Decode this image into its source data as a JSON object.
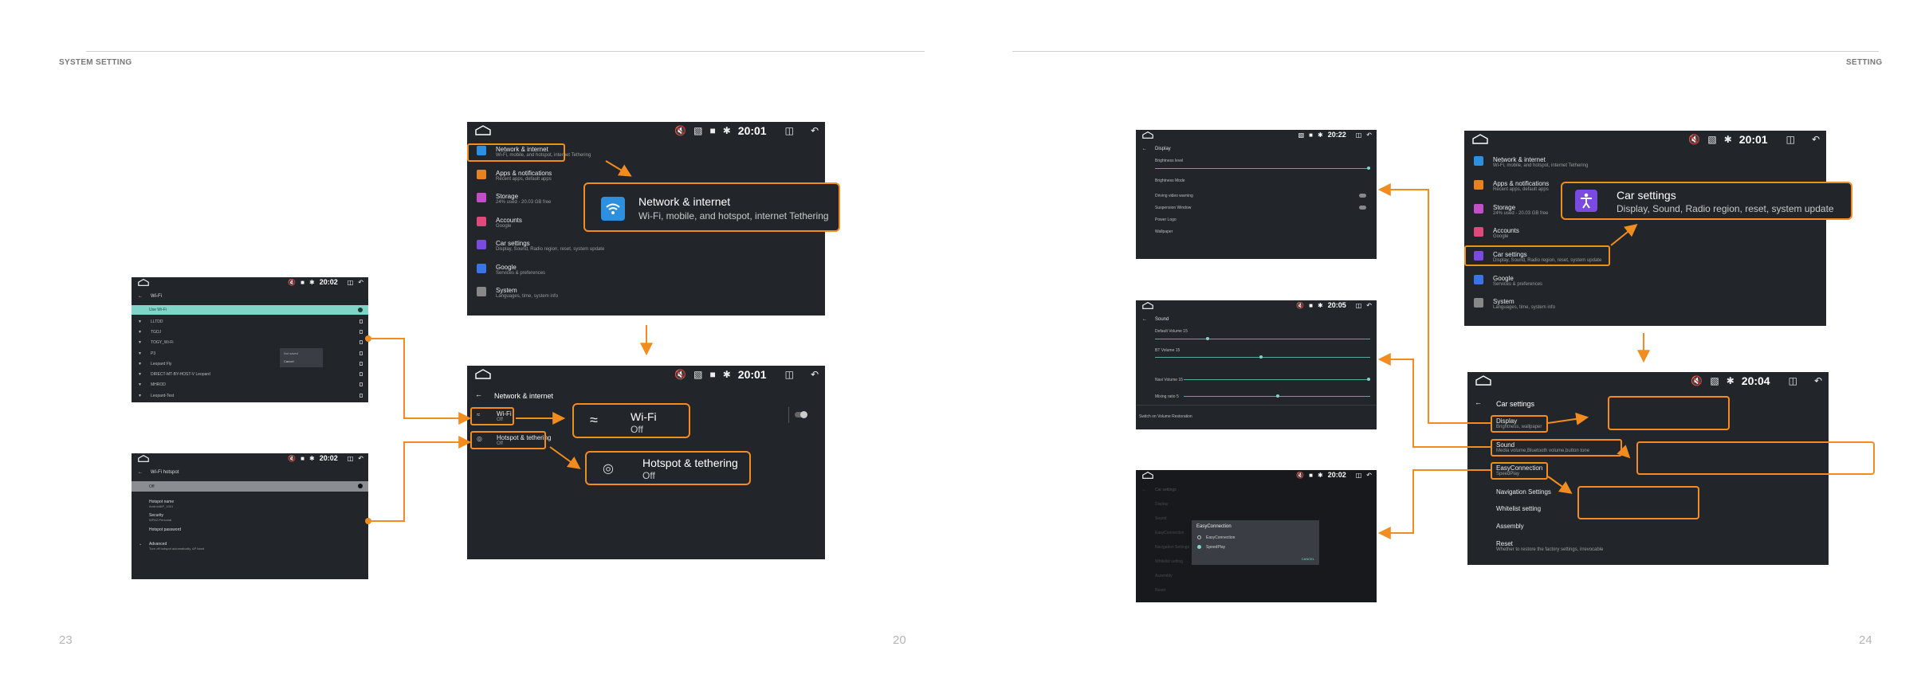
{
  "left_page": {
    "header": "SYSTEM SETTING",
    "page_number": "23",
    "page_number_right": "20"
  },
  "right_page": {
    "header": "SETTING",
    "page_number": "24"
  },
  "times": {
    "t2001": "20:01",
    "t2002": "20:02",
    "t2022": "20:22",
    "t2005": "20:05",
    "t2004": "20:04"
  },
  "settings_menu": {
    "items": [
      {
        "title": "Network & internet",
        "subtitle": "Wi-Fi, mobile, and hotspot, internet Tethering"
      },
      {
        "title": "Apps & notifications",
        "subtitle": "Recent apps, default apps"
      },
      {
        "title": "Storage",
        "subtitle": "24% used - 20.03 GB free"
      },
      {
        "title": "Accounts",
        "subtitle": "Google"
      },
      {
        "title": "Car settings",
        "subtitle": "Display, Sound, Radio region, reset, system update"
      },
      {
        "title": "Google",
        "subtitle": "Services & preferences"
      },
      {
        "title": "System",
        "subtitle": "Languages, time, system info"
      }
    ]
  },
  "network_callout": {
    "title": "Network & internet",
    "subtitle": "Wi-Fi, mobile, and hotspot, internet Tethering"
  },
  "network_screen": {
    "title": "Network & internet",
    "wifi": {
      "title": "Wi-Fi",
      "subtitle": "Off"
    },
    "hotspot": {
      "title": "Hotspot & tethering",
      "subtitle": "Off"
    }
  },
  "wifi_callout": {
    "title": "Wi-Fi",
    "subtitle": "Off"
  },
  "hotspot_callout": {
    "title": "Hotspot & tethering",
    "subtitle": "Off"
  },
  "wifi_screen": {
    "title": "Wi-Fi",
    "networks": [
      "Use Wi-Fi",
      "LLTDD",
      "TGDJ",
      "TOGY_Wi-Fi",
      "P3",
      "Leopard Fly",
      "DIRECT-MT-BY-HOST-V Leopard",
      "MHROD",
      "Leopard-Test"
    ],
    "popup": [
      "Not saved",
      "Cancel"
    ]
  },
  "hotspot_screen": {
    "title": "Wi-Fi hotspot",
    "rows": [
      {
        "title": "Off",
        "subtitle": ""
      },
      {
        "title": "Hotspot name",
        "subtitle": "AndroidAP_1001"
      },
      {
        "title": "Security",
        "subtitle": "WPA2-Personal"
      },
      {
        "title": "Hotspot password",
        "subtitle": ""
      },
      {
        "title": "Advanced",
        "subtitle": "Turn off hotspot automatically, AP band"
      }
    ]
  },
  "car_callout": {
    "title": "Car settings",
    "subtitle": "Display, Sound, Radio region, reset, system update"
  },
  "car_screen": {
    "title": "Car settings",
    "items": [
      {
        "title": "Display",
        "subtitle": "Brightness, wallpaper"
      },
      {
        "title": "Sound",
        "subtitle": "Media volume,Bluetooth volume,button tone"
      },
      {
        "title": "EasyConnection",
        "subtitle": "SpeedPlay"
      },
      {
        "title": "Navigation Settings",
        "subtitle": ""
      },
      {
        "title": "Whitelist setting",
        "subtitle": ""
      },
      {
        "title": "Assembly",
        "subtitle": ""
      },
      {
        "title": "Reset",
        "subtitle": "Whether to restore the factory settings, irrevocable"
      }
    ]
  },
  "display_screen": {
    "title": "Display",
    "rows": [
      "Brightness level",
      "Brightness Mode",
      "Driving video warning",
      "Suspension Window",
      "Power Logo",
      "Wallpaper"
    ]
  },
  "sound_screen": {
    "title": "Sound",
    "rows": [
      "Default Volume  15",
      "BT Volume  15",
      "Navi Volume  15",
      "Mixing ratio  5",
      "Switch on Volume Restoration"
    ]
  },
  "easy_screen": {
    "dialog_title": "EasyConnection",
    "options": [
      "EasyConnection",
      "SpeedPlay"
    ],
    "cancel": "CANCEL"
  },
  "colors": {
    "accent": "#f28c1e",
    "screen_bg": "#22262b",
    "highlight_teal": "#7fd6c8"
  }
}
